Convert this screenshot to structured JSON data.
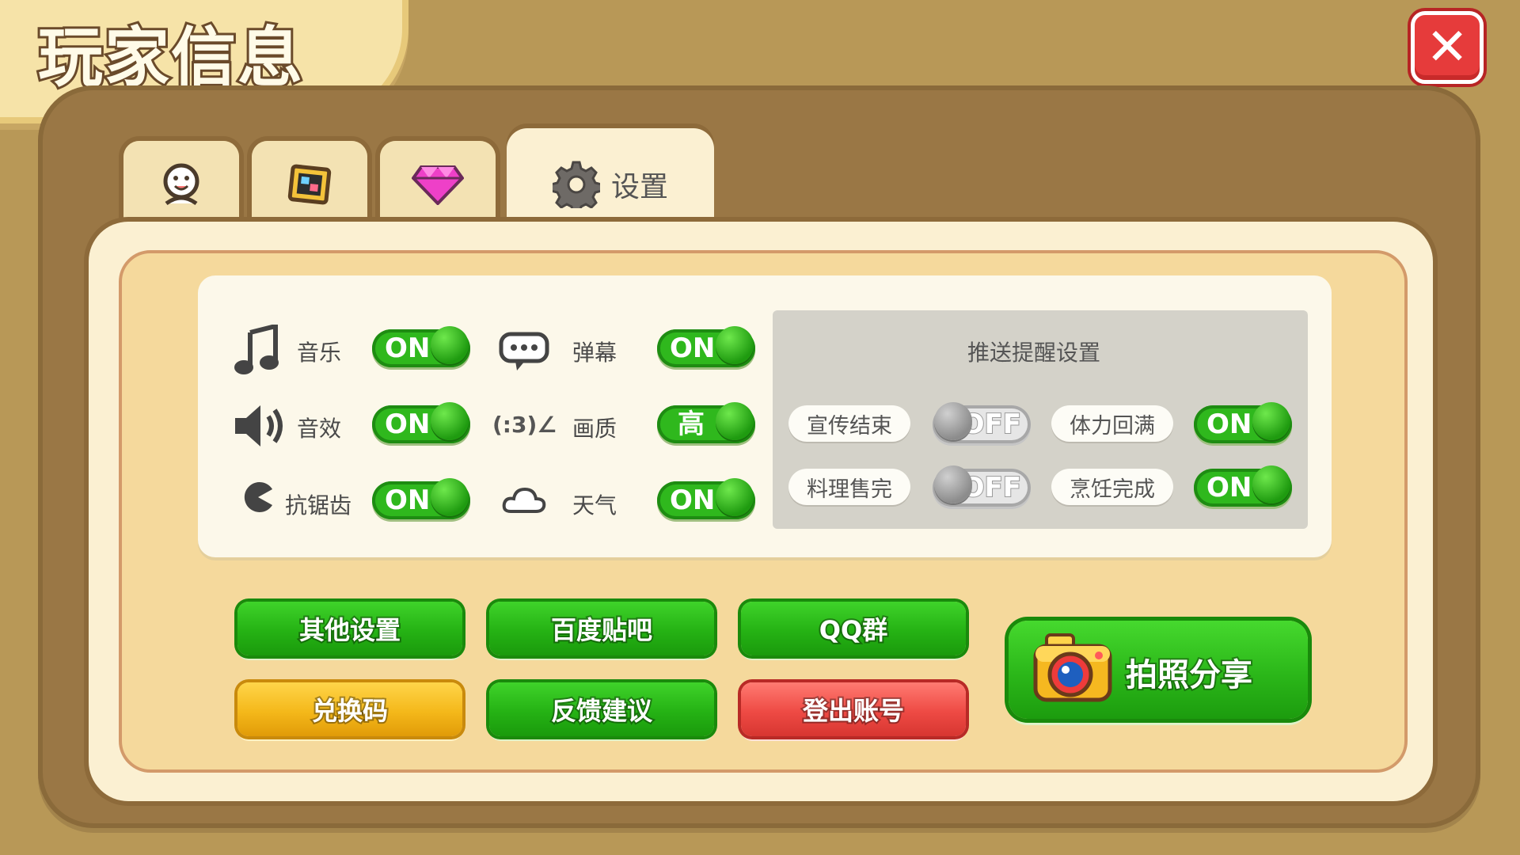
{
  "title": "玩家信息",
  "close_label": "✕",
  "tabs": [
    {
      "icon": "avatar-icon"
    },
    {
      "icon": "photo-album-icon"
    },
    {
      "icon": "diamond-icon"
    },
    {
      "icon": "gear-icon",
      "label": "设置"
    }
  ],
  "settings": {
    "music": {
      "label": "音乐",
      "state": "ON",
      "icon": "music-note-icon"
    },
    "sound": {
      "label": "音效",
      "state": "ON",
      "icon": "speaker-icon"
    },
    "antialias": {
      "label": "抗锯齿",
      "state": "ON",
      "icon": "pacman-icon"
    },
    "danmaku": {
      "label": "弹幕",
      "state": "ON",
      "icon": "chat-bubble-icon"
    },
    "quality": {
      "label": "画质",
      "state": "高",
      "icon_text": "(:3)∠"
    },
    "weather": {
      "label": "天气",
      "state": "ON",
      "icon": "cloud-icon"
    }
  },
  "push": {
    "title": "推送提醒设置",
    "items": [
      {
        "label": "宣传结束",
        "state": "OFF"
      },
      {
        "label": "体力回满",
        "state": "ON"
      },
      {
        "label": "料理售完",
        "state": "OFF"
      },
      {
        "label": "烹饪完成",
        "state": "ON"
      }
    ]
  },
  "buttons": {
    "other_settings": "其他设置",
    "baidu_tieba": "百度贴吧",
    "qq_group": "QQ群",
    "redeem_code": "兑换码",
    "feedback": "反馈建议",
    "logout": "登出账号",
    "photo_share": "拍照分享"
  },
  "colors": {
    "toggle_on": "#2fb81d",
    "toggle_off": "#e6e6e6",
    "button_green": "#25b214",
    "button_yellow": "#f4b81a",
    "button_red": "#ee4a44",
    "close": "#e63b3b"
  }
}
